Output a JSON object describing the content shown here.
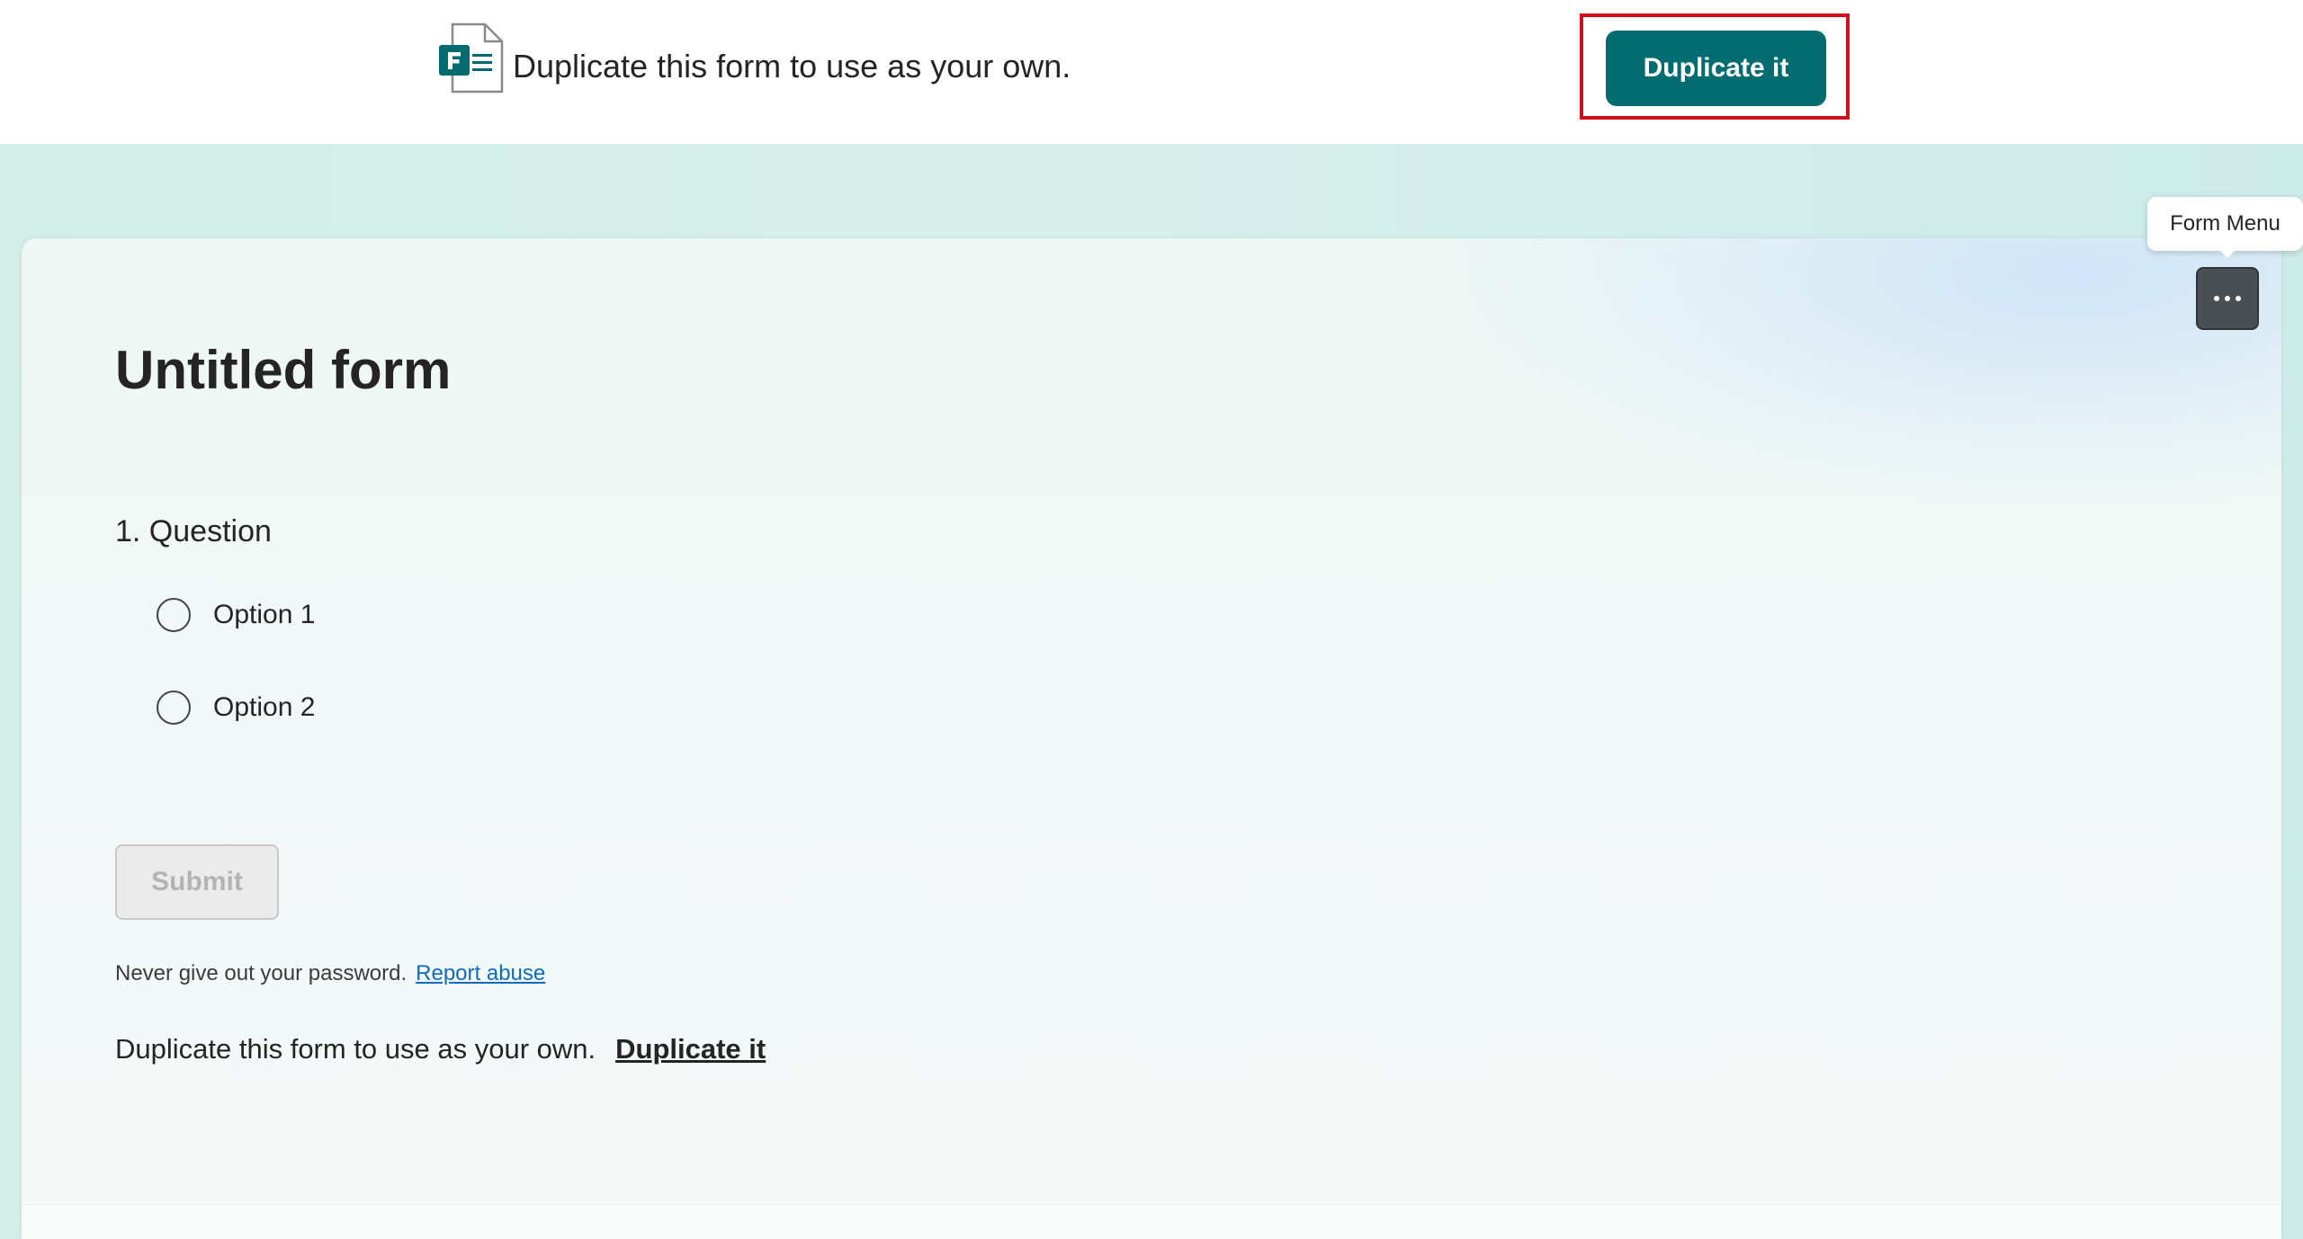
{
  "banner": {
    "logo_icon": "microsoft-forms-logo-icon",
    "text": "Duplicate this form to use as your own.",
    "duplicate_button_label": "Duplicate it",
    "accent_color": "#036c70",
    "highlight_color": "#d40f1c"
  },
  "form": {
    "title": "Untitled form",
    "question": {
      "title": "1. Question",
      "options": [
        {
          "label": "Option 1"
        },
        {
          "label": "Option 2"
        }
      ]
    },
    "submit_label": "Submit",
    "password_note": "Never give out your password.",
    "report_abuse_label": "Report abuse",
    "duplicate_text": "Duplicate this form to use as your own.",
    "duplicate_link_label": "Duplicate it"
  },
  "form_menu": {
    "tooltip": "Form Menu",
    "icon": "more-horizontal-icon"
  }
}
